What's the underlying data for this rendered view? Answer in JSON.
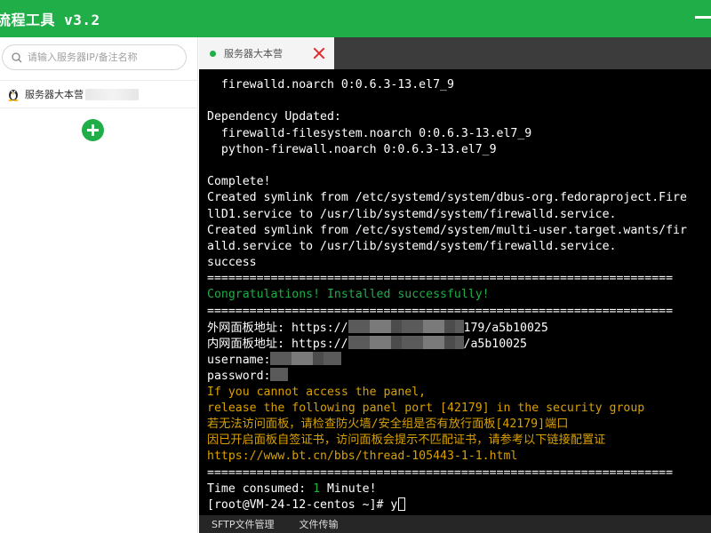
{
  "window": {
    "title": "流程工具 v3.2"
  },
  "sidebar": {
    "search_placeholder": "请输入服务器IP/备注名称",
    "servers": [
      {
        "name": "服务器大本营"
      }
    ]
  },
  "tabs": [
    {
      "label": "服务器大本营",
      "status_color": "#1fae47"
    }
  ],
  "terminal": {
    "lines": [
      {
        "text": "  firewalld.noarch 0:0.6.3-13.el7_9",
        "color": "white"
      },
      {
        "text": "",
        "color": "white"
      },
      {
        "text": "Dependency Updated:",
        "color": "white"
      },
      {
        "text": "  firewalld-filesystem.noarch 0:0.6.3-13.el7_9",
        "color": "white"
      },
      {
        "text": "  python-firewall.noarch 0:0.6.3-13.el7_9",
        "color": "white"
      },
      {
        "text": "",
        "color": "white"
      },
      {
        "text": "Complete!",
        "color": "white"
      },
      {
        "text": "Created symlink from /etc/systemd/system/dbus-org.fedoraproject.Fire",
        "color": "white"
      },
      {
        "text": "llD1.service to /usr/lib/systemd/system/firewalld.service.",
        "color": "white"
      },
      {
        "text": "Created symlink from /etc/systemd/system/multi-user.target.wants/fir",
        "color": "white"
      },
      {
        "text": "alld.service to /usr/lib/systemd/system/firewalld.service.",
        "color": "white"
      },
      {
        "text": "success",
        "color": "white"
      },
      {
        "text": "==================================================================",
        "color": "white"
      },
      {
        "text": "Congratulations! Installed successfully!",
        "color": "green"
      },
      {
        "text": "==================================================================",
        "color": "white"
      },
      {
        "text": "外网面板地址: https://",
        "color": "white",
        "mask_width": 130,
        "suffix": "179/a5b10025"
      },
      {
        "text": "内网面板地址: https://",
        "color": "white",
        "mask_width": 130,
        "suffix": "/a5b10025"
      },
      {
        "text": "username:",
        "color": "white",
        "mask_width": 80,
        "suffix": ""
      },
      {
        "text": "password:",
        "color": "white",
        "mask_width": 20,
        "suffix": ""
      },
      {
        "text": "If you cannot access the panel,",
        "color": "orange"
      },
      {
        "text": "release the following panel port [42179] in the security group",
        "color": "orange"
      },
      {
        "text": "若无法访问面板，请检查防火墙/安全组是否有放行面板[42179]端口",
        "color": "orange"
      },
      {
        "text": "因已开启面板自签证书，访问面板会提示不匹配证书，请参考以下链接配置证",
        "color": "orange"
      },
      {
        "text": "https://www.bt.cn/bbs/thread-105443-1-1.html",
        "color": "orange"
      },
      {
        "text": "==================================================================",
        "color": "white"
      },
      {
        "text": "Time consumed: ",
        "color": "white",
        "highlight": "1",
        "tail": " Minute!"
      },
      {
        "text": "[root@VM-24-12-centos ~]# y",
        "color": "white",
        "cursor": true
      }
    ]
  },
  "bottom_tabs": [
    {
      "label": "SFTP文件管理"
    },
    {
      "label": "文件传输"
    }
  ],
  "colors": {
    "accent": "#1fae47",
    "warning": "#d9a000",
    "close": "#e02b2b"
  }
}
